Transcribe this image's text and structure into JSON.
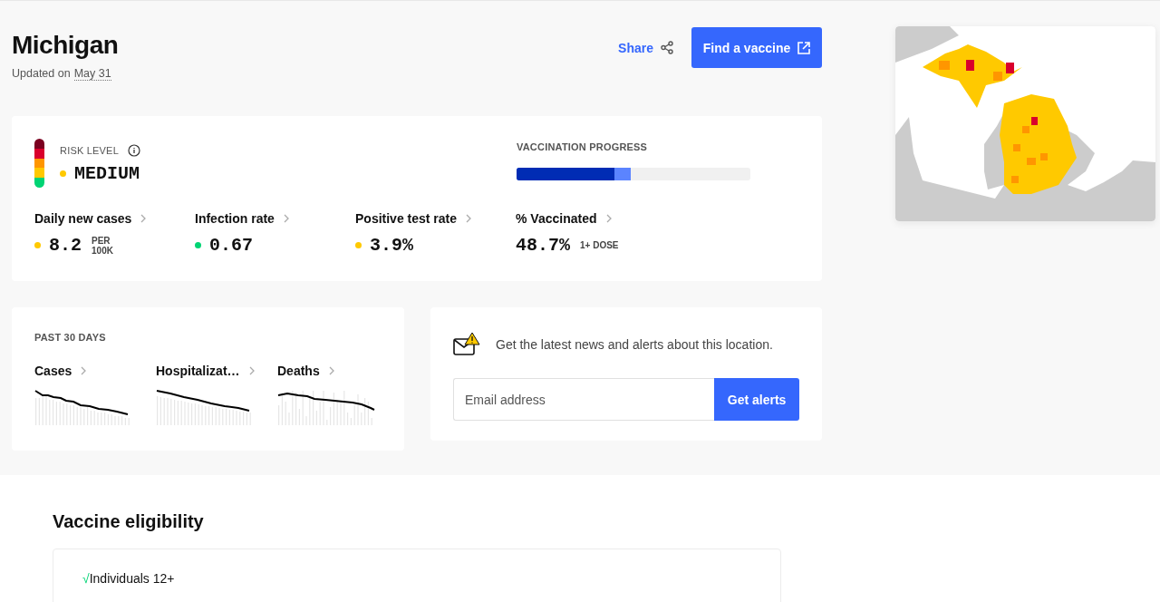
{
  "header": {
    "title": "Michigan",
    "updated_prefix": "Updated on",
    "updated_date": "May 31",
    "share": "Share",
    "find_button": "Find a vaccine"
  },
  "risk": {
    "label": "RISK LEVEL",
    "value": "MEDIUM",
    "color": "#ffc900"
  },
  "vaccination": {
    "label": "VACCINATION PROGRESS",
    "segments": [
      {
        "level": 0.42,
        "color": "#002cb4"
      },
      {
        "level": 0.487,
        "color": "#5b84ff"
      }
    ]
  },
  "metrics": [
    {
      "name": "Daily new cases",
      "value": "8.2",
      "unit_top": "PER",
      "unit_bottom": "100K",
      "color": "#ffc900"
    },
    {
      "name": "Infection rate",
      "value": "0.67",
      "color": "#00d474"
    },
    {
      "name": "Positive test rate",
      "value": "3.9%",
      "color": "#ffc900"
    },
    {
      "name": "% Vaccinated",
      "value": "48.7%",
      "unit_top": "1+ DOSE"
    }
  ],
  "trends": {
    "label": "PAST 30 DAYS",
    "items": [
      {
        "name": "Cases"
      },
      {
        "name": "Hospitalizat…"
      },
      {
        "name": "Deaths"
      }
    ]
  },
  "alerts": {
    "text": "Get the latest news and alerts about this location.",
    "placeholder": "Email address",
    "button": "Get alerts"
  },
  "eligibility": {
    "title": "Vaccine eligibility",
    "items": [
      {
        "mark": "√",
        "text": "Individuals 12+"
      }
    ]
  }
}
